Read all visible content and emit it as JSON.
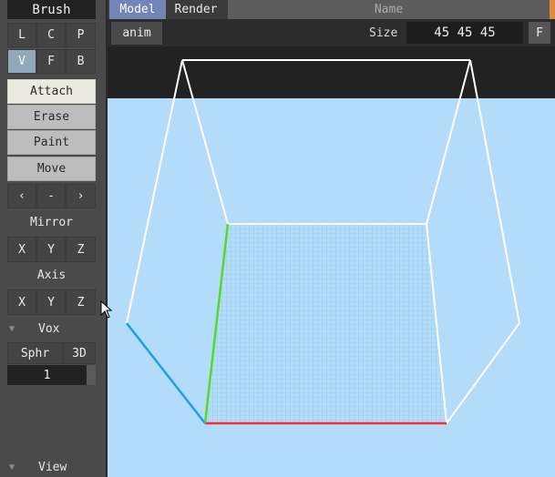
{
  "sidebar": {
    "title": "Brush",
    "mode_row1": [
      "L",
      "C",
      "P"
    ],
    "mode_row2": [
      "V",
      "F",
      "B"
    ],
    "tools": {
      "attach": "Attach",
      "erase": "Erase",
      "paint": "Paint",
      "move": "Move"
    },
    "nav": [
      "‹",
      "-",
      "›"
    ],
    "mirror": {
      "label": "Mirror",
      "axes": [
        "X",
        "Y",
        "Z"
      ]
    },
    "axis": {
      "label": "Axis",
      "axes": [
        "X",
        "Y",
        "Z"
      ]
    },
    "vox": {
      "label": "Vox",
      "shape": "Sphr",
      "dim": "3D",
      "value": "1"
    },
    "view": {
      "label": "View"
    }
  },
  "topbar": {
    "tabs": [
      "Model",
      "Render"
    ],
    "name_label": "Name",
    "accent_color": "#e08a3c"
  },
  "subbar": {
    "anim_tab": "anim",
    "size_label": "Size",
    "size_value": "45 45 45",
    "f_button": "F"
  },
  "viewport": {
    "background": "#b2dcfa",
    "x_axis_color": "#ff2a2a",
    "y_axis_color": "#58d92a",
    "z_axis_color": "#1aa0e8"
  }
}
